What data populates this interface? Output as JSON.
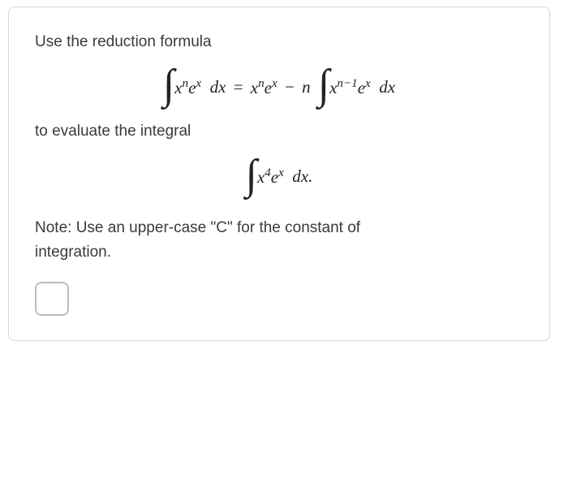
{
  "problem": {
    "intro": "Use the reduction formula",
    "formula": {
      "lhs_int": "∫",
      "lhs_body": "xⁿeˣ dx",
      "eq": "=",
      "rhs_term1": "xⁿeˣ",
      "minus": "−",
      "rhs_coef": "n",
      "rhs_int": "∫",
      "rhs_body": "xⁿ⁻¹eˣ dx"
    },
    "mid": "to evaluate the integral",
    "integral": {
      "int": "∫",
      "body": "x⁴eˣ dx."
    },
    "note_prefix": "Note: Use an upper-case \"C\" for the constant of",
    "note_suffix": "integration.",
    "answer_value": ""
  }
}
